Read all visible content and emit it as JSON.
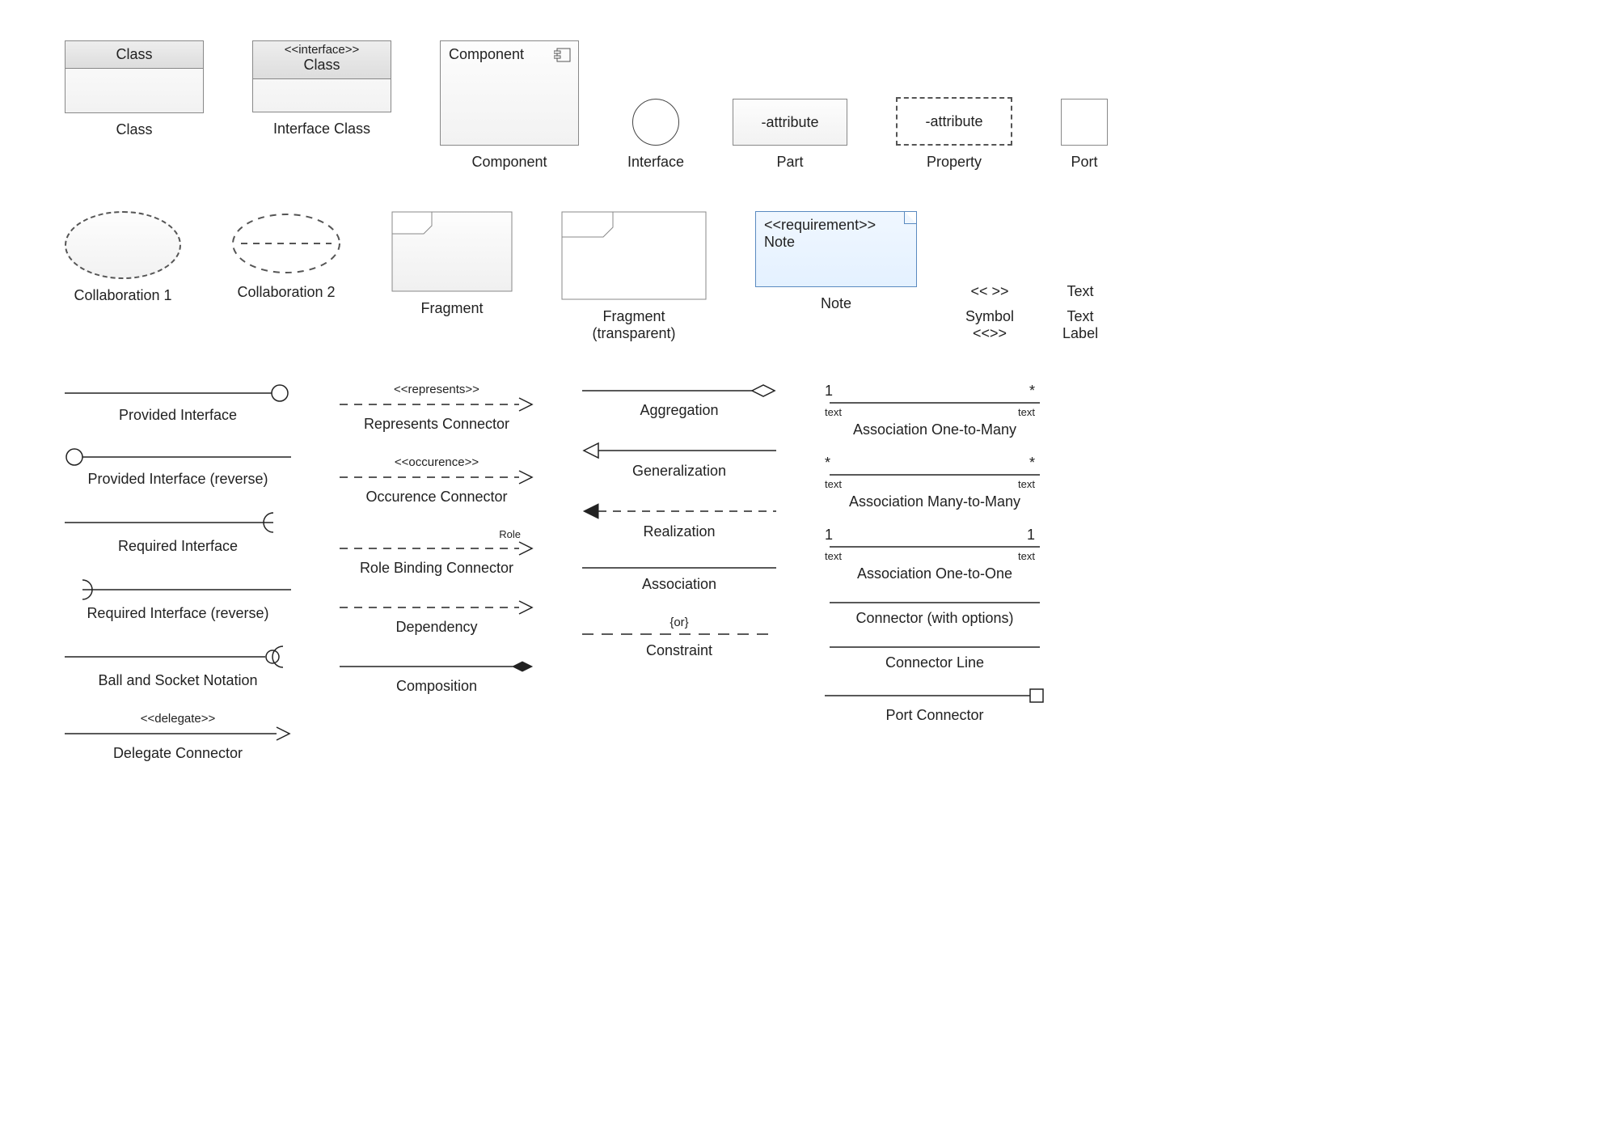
{
  "row1": {
    "class": {
      "header": "Class",
      "caption": "Class"
    },
    "ifaceClass": {
      "stereo": "<<interface>>",
      "header": "Class",
      "caption": "Interface Class"
    },
    "component": {
      "title": "Component",
      "caption": "Component"
    },
    "interface": {
      "caption": "Interface"
    },
    "part": {
      "text": "-attribute",
      "caption": "Part"
    },
    "property": {
      "text": "-attribute",
      "caption": "Property"
    },
    "port": {
      "caption": "Port"
    }
  },
  "row2": {
    "collab1": {
      "caption": "Collaboration 1"
    },
    "collab2": {
      "caption": "Collaboration 2"
    },
    "fragment": {
      "caption": "Fragment"
    },
    "fragmentTrans": {
      "caption1": "Fragment",
      "caption2": "(transparent)"
    },
    "note": {
      "stereo": "<<requirement>>",
      "text": "Note",
      "caption": "Note"
    },
    "symbol": {
      "display": "<< >>",
      "caption1": "Symbol",
      "caption2": "<<>>"
    },
    "textLabel": {
      "display": "Text",
      "caption1": "Text",
      "caption2": "Label"
    }
  },
  "connectors": {
    "col1": {
      "provided": "Provided Interface",
      "providedRev": "Provided Interface (reverse)",
      "required": "Required Interface",
      "requiredRev": "Required Interface (reverse)",
      "ballSocket": "Ball and Socket Notation",
      "delegate": {
        "stereo": "<<delegate>>",
        "label": "Delegate Connector"
      }
    },
    "col2": {
      "represents": {
        "stereo": "<<represents>>",
        "label": "Represents Connector"
      },
      "occurence": {
        "stereo": "<<occurence>>",
        "label": "Occurence Connector"
      },
      "roleBinding": {
        "hint": "Role",
        "label": "Role Binding Connector"
      },
      "dependency": "Dependency",
      "composition": "Composition"
    },
    "col3": {
      "aggregation": "Aggregation",
      "generalization": "Generalization",
      "realization": "Realization",
      "association": "Association",
      "constraint": {
        "hint": "{or}",
        "label": "Constraint"
      }
    },
    "col4": {
      "oneToMany": {
        "left": "1",
        "right": "*",
        "tl": "text",
        "tr": "text",
        "label": "Association One-to-Many"
      },
      "manyToMany": {
        "left": "*",
        "right": "*",
        "tl": "text",
        "tr": "text",
        "label": "Association Many-to-Many"
      },
      "oneToOne": {
        "left": "1",
        "right": "1",
        "tl": "text",
        "tr": "text",
        "label": "Association One-to-One"
      },
      "connOpts": "Connector (with options)",
      "connLine": "Connector Line",
      "portConn": "Port Connector"
    }
  }
}
